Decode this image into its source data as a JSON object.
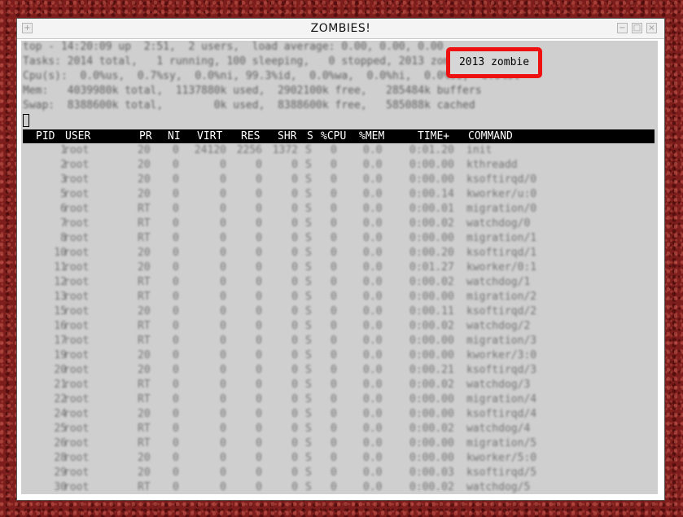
{
  "window": {
    "title": "ZOMBIES!"
  },
  "summary_lines": [
    "top - 14:20:09 up  2:51,  2 users,  load average: 0.00, 0.00, 0.00",
    "Tasks: 2014 total,   1 running, 100 sleeping,   0 stopped, 2013 zombie",
    "Cpu(s):  0.0%us,  0.7%sy,  0.0%ni, 99.3%id,  0.0%wa,  0.0%hi,  0.0%si,  0.0%st",
    "Mem:   4039980k total,  1137880k used,  2902100k free,   285484k buffers",
    "Swap:  8388600k total,        0k used,  8388600k free,   585088k cached"
  ],
  "callout": {
    "text": "2013 zombie"
  },
  "table": {
    "columns": {
      "pid": "PID",
      "user": "USER",
      "pr": "PR",
      "ni": "NI",
      "virt": "VIRT",
      "res": "RES",
      "shr": "SHR",
      "s": "S",
      "cpu": "%CPU",
      "mem": "%MEM",
      "time": "TIME+",
      "command": "COMMAND"
    },
    "rows": [
      {
        "pid": "1",
        "user": "root",
        "pr": "20",
        "ni": "0",
        "virt": "24120",
        "res": "2256",
        "shr": "1372",
        "s": "S",
        "cpu": "0",
        "mem": "0.0",
        "time": "0:01.20",
        "command": "init"
      },
      {
        "pid": "2",
        "user": "root",
        "pr": "20",
        "ni": "0",
        "virt": "0",
        "res": "0",
        "shr": "0",
        "s": "S",
        "cpu": "0",
        "mem": "0.0",
        "time": "0:00.00",
        "command": "kthreadd"
      },
      {
        "pid": "3",
        "user": "root",
        "pr": "20",
        "ni": "0",
        "virt": "0",
        "res": "0",
        "shr": "0",
        "s": "S",
        "cpu": "0",
        "mem": "0.0",
        "time": "0:00.00",
        "command": "ksoftirqd/0"
      },
      {
        "pid": "5",
        "user": "root",
        "pr": "20",
        "ni": "0",
        "virt": "0",
        "res": "0",
        "shr": "0",
        "s": "S",
        "cpu": "0",
        "mem": "0.0",
        "time": "0:00.14",
        "command": "kworker/u:0"
      },
      {
        "pid": "6",
        "user": "root",
        "pr": "RT",
        "ni": "0",
        "virt": "0",
        "res": "0",
        "shr": "0",
        "s": "S",
        "cpu": "0",
        "mem": "0.0",
        "time": "0:00.01",
        "command": "migration/0"
      },
      {
        "pid": "7",
        "user": "root",
        "pr": "RT",
        "ni": "0",
        "virt": "0",
        "res": "0",
        "shr": "0",
        "s": "S",
        "cpu": "0",
        "mem": "0.0",
        "time": "0:00.02",
        "command": "watchdog/0"
      },
      {
        "pid": "8",
        "user": "root",
        "pr": "RT",
        "ni": "0",
        "virt": "0",
        "res": "0",
        "shr": "0",
        "s": "S",
        "cpu": "0",
        "mem": "0.0",
        "time": "0:00.00",
        "command": "migration/1"
      },
      {
        "pid": "10",
        "user": "root",
        "pr": "20",
        "ni": "0",
        "virt": "0",
        "res": "0",
        "shr": "0",
        "s": "S",
        "cpu": "0",
        "mem": "0.0",
        "time": "0:00.20",
        "command": "ksoftirqd/1"
      },
      {
        "pid": "11",
        "user": "root",
        "pr": "20",
        "ni": "0",
        "virt": "0",
        "res": "0",
        "shr": "0",
        "s": "S",
        "cpu": "0",
        "mem": "0.0",
        "time": "0:01.27",
        "command": "kworker/0:1"
      },
      {
        "pid": "12",
        "user": "root",
        "pr": "RT",
        "ni": "0",
        "virt": "0",
        "res": "0",
        "shr": "0",
        "s": "S",
        "cpu": "0",
        "mem": "0.0",
        "time": "0:00.02",
        "command": "watchdog/1"
      },
      {
        "pid": "13",
        "user": "root",
        "pr": "RT",
        "ni": "0",
        "virt": "0",
        "res": "0",
        "shr": "0",
        "s": "S",
        "cpu": "0",
        "mem": "0.0",
        "time": "0:00.00",
        "command": "migration/2"
      },
      {
        "pid": "15",
        "user": "root",
        "pr": "20",
        "ni": "0",
        "virt": "0",
        "res": "0",
        "shr": "0",
        "s": "S",
        "cpu": "0",
        "mem": "0.0",
        "time": "0:00.11",
        "command": "ksoftirqd/2"
      },
      {
        "pid": "16",
        "user": "root",
        "pr": "RT",
        "ni": "0",
        "virt": "0",
        "res": "0",
        "shr": "0",
        "s": "S",
        "cpu": "0",
        "mem": "0.0",
        "time": "0:00.02",
        "command": "watchdog/2"
      },
      {
        "pid": "17",
        "user": "root",
        "pr": "RT",
        "ni": "0",
        "virt": "0",
        "res": "0",
        "shr": "0",
        "s": "S",
        "cpu": "0",
        "mem": "0.0",
        "time": "0:00.00",
        "command": "migration/3"
      },
      {
        "pid": "19",
        "user": "root",
        "pr": "20",
        "ni": "0",
        "virt": "0",
        "res": "0",
        "shr": "0",
        "s": "S",
        "cpu": "0",
        "mem": "0.0",
        "time": "0:00.00",
        "command": "kworker/3:0"
      },
      {
        "pid": "20",
        "user": "root",
        "pr": "20",
        "ni": "0",
        "virt": "0",
        "res": "0",
        "shr": "0",
        "s": "S",
        "cpu": "0",
        "mem": "0.0",
        "time": "0:00.21",
        "command": "ksoftirqd/3"
      },
      {
        "pid": "21",
        "user": "root",
        "pr": "RT",
        "ni": "0",
        "virt": "0",
        "res": "0",
        "shr": "0",
        "s": "S",
        "cpu": "0",
        "mem": "0.0",
        "time": "0:00.02",
        "command": "watchdog/3"
      },
      {
        "pid": "22",
        "user": "root",
        "pr": "RT",
        "ni": "0",
        "virt": "0",
        "res": "0",
        "shr": "0",
        "s": "S",
        "cpu": "0",
        "mem": "0.0",
        "time": "0:00.00",
        "command": "migration/4"
      },
      {
        "pid": "24",
        "user": "root",
        "pr": "20",
        "ni": "0",
        "virt": "0",
        "res": "0",
        "shr": "0",
        "s": "S",
        "cpu": "0",
        "mem": "0.0",
        "time": "0:00.00",
        "command": "ksoftirqd/4"
      },
      {
        "pid": "25",
        "user": "root",
        "pr": "RT",
        "ni": "0",
        "virt": "0",
        "res": "0",
        "shr": "0",
        "s": "S",
        "cpu": "0",
        "mem": "0.0",
        "time": "0:00.02",
        "command": "watchdog/4"
      },
      {
        "pid": "26",
        "user": "root",
        "pr": "RT",
        "ni": "0",
        "virt": "0",
        "res": "0",
        "shr": "0",
        "s": "S",
        "cpu": "0",
        "mem": "0.0",
        "time": "0:00.00",
        "command": "migration/5"
      },
      {
        "pid": "28",
        "user": "root",
        "pr": "20",
        "ni": "0",
        "virt": "0",
        "res": "0",
        "shr": "0",
        "s": "S",
        "cpu": "0",
        "mem": "0.0",
        "time": "0:00.00",
        "command": "kworker/5:0"
      },
      {
        "pid": "29",
        "user": "root",
        "pr": "20",
        "ni": "0",
        "virt": "0",
        "res": "0",
        "shr": "0",
        "s": "S",
        "cpu": "0",
        "mem": "0.0",
        "time": "0:00.03",
        "command": "ksoftirqd/5"
      },
      {
        "pid": "30",
        "user": "root",
        "pr": "RT",
        "ni": "0",
        "virt": "0",
        "res": "0",
        "shr": "0",
        "s": "S",
        "cpu": "0",
        "mem": "0.0",
        "time": "0:00.02",
        "command": "watchdog/5"
      }
    ]
  }
}
